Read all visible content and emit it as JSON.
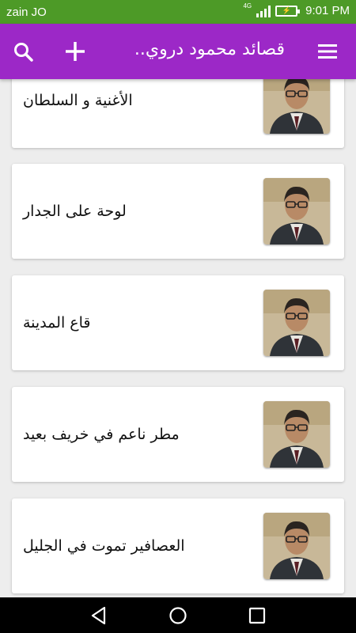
{
  "status": {
    "carrier": "zain JO",
    "network": "4G",
    "time": "9:01 PM",
    "icons": [
      "signal-icon",
      "battery-charging-icon"
    ]
  },
  "appbar": {
    "title": "قصائد محمود دروي..",
    "icons": [
      "search-icon",
      "add-icon",
      "menu-icon"
    ],
    "color": "#9c28c7"
  },
  "poems": [
    {
      "title": "الأغنية و السلطان"
    },
    {
      "title": "لوحة على الجدار"
    },
    {
      "title": "قاع المدينة"
    },
    {
      "title": "مطر ناعم في خريف بعيد"
    },
    {
      "title": "العصافير تموت في الجليل"
    }
  ],
  "navbar": {
    "icons": [
      "back-icon",
      "home-icon",
      "recents-icon"
    ]
  },
  "colors": {
    "status_bar": "#4d9a27",
    "app_bar": "#9c28c7",
    "background": "#ededed"
  }
}
